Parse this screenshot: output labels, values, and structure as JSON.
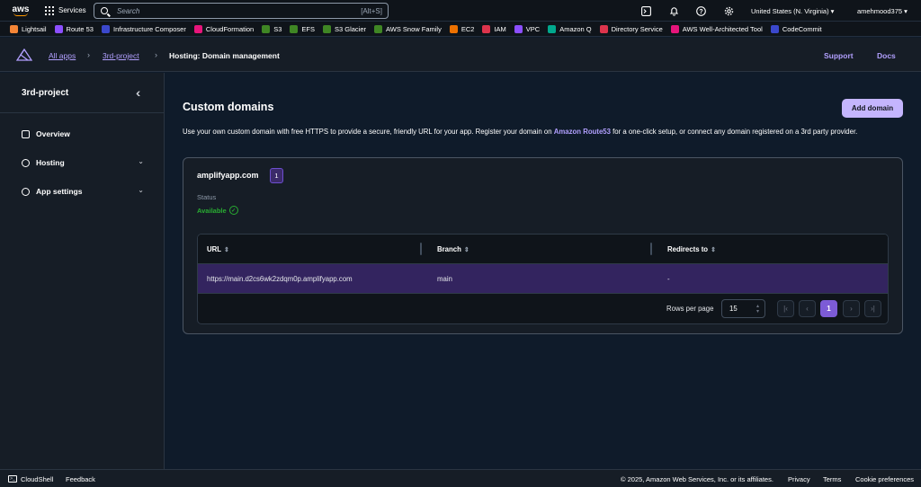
{
  "topnav": {
    "logo_text": "aws",
    "services_label": "Services",
    "search_placeholder": "Search",
    "search_shortcut": "[Alt+S]",
    "region": "United States (N. Virginia) ▾",
    "user": "amehmood375 ▾"
  },
  "favorites": [
    {
      "label": "Lightsail",
      "color": "#f58536"
    },
    {
      "label": "Route 53",
      "color": "#8c4fff"
    },
    {
      "label": "Infrastructure Composer",
      "color": "#3b48cc"
    },
    {
      "label": "CloudFormation",
      "color": "#e7157b"
    },
    {
      "label": "S3",
      "color": "#3f8624"
    },
    {
      "label": "EFS",
      "color": "#3f8624"
    },
    {
      "label": "S3 Glacier",
      "color": "#3f8624"
    },
    {
      "label": "AWS Snow Family",
      "color": "#3f8624"
    },
    {
      "label": "EC2",
      "color": "#ed7100"
    },
    {
      "label": "IAM",
      "color": "#dd344c"
    },
    {
      "label": "VPC",
      "color": "#8c4fff"
    },
    {
      "label": "Amazon Q",
      "color": "#01a88d"
    },
    {
      "label": "Directory Service",
      "color": "#dd344c"
    },
    {
      "label": "AWS Well-Architected Tool",
      "color": "#e7157b"
    },
    {
      "label": "CodeCommit",
      "color": "#3b48cc"
    }
  ],
  "appbar": {
    "crumb_all_apps": "All apps",
    "crumb_project": "3rd-project",
    "crumb_current": "Hosting: Domain management",
    "support": "Support",
    "docs": "Docs"
  },
  "sidebar": {
    "title": "3rd-project",
    "items": [
      {
        "label": "Overview"
      },
      {
        "label": "Hosting"
      },
      {
        "label": "App settings"
      }
    ]
  },
  "main": {
    "title": "Custom domains",
    "add_button": "Add domain",
    "desc_part1": "Use your own custom domain with free HTTPS to provide a secure, friendly URL for your app. Register your domain on ",
    "desc_link": "Amazon Route53",
    "desc_part2": " for a one-click setup, or connect any domain registered on a 3rd party provider.",
    "domain": {
      "name": "amplifyapp.com",
      "count": "1",
      "status_label": "Status",
      "status_value": "Available"
    },
    "table": {
      "columns": [
        "URL",
        "Branch",
        "Redirects to"
      ],
      "rows": [
        {
          "url": "https://main.d2cs6wk2zdqm0p.amplifyapp.com",
          "branch": "main",
          "redirects": "-"
        }
      ],
      "rows_per_page_label": "Rows per page",
      "rows_per_page_value": "15",
      "current_page": "1"
    }
  },
  "footer": {
    "cloudshell": "CloudShell",
    "feedback": "Feedback",
    "copyright": "© 2025, Amazon Web Services, Inc. or its affiliates.",
    "privacy": "Privacy",
    "terms": "Terms",
    "cookies": "Cookie preferences"
  }
}
